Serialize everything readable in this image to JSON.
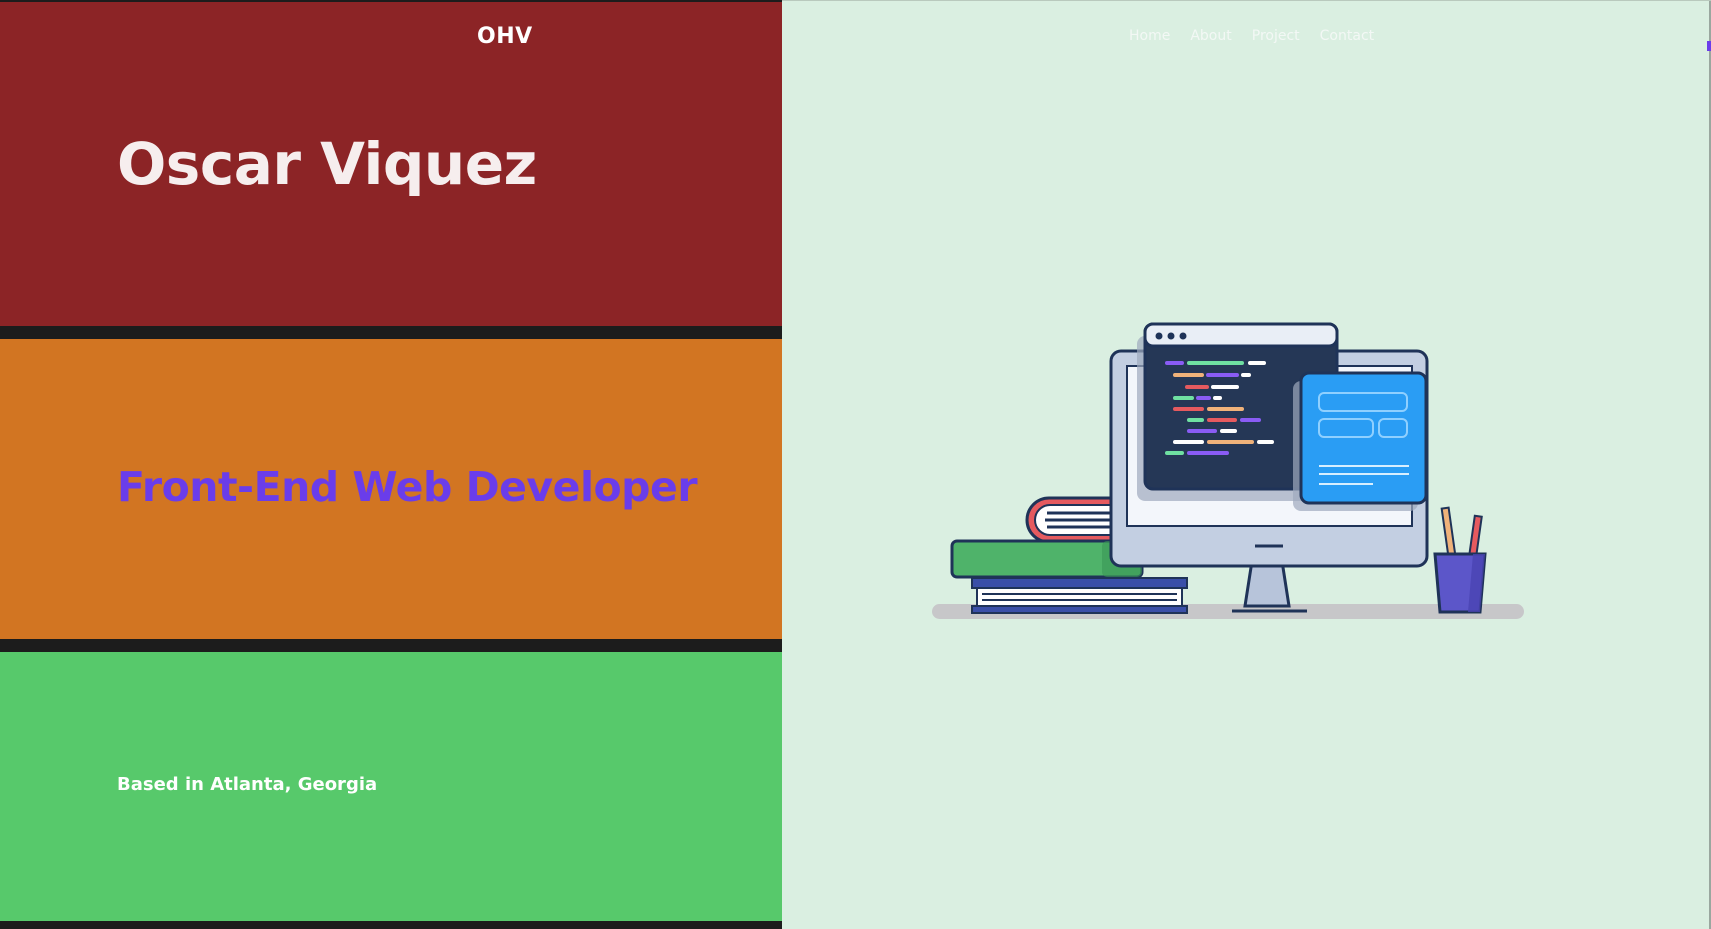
{
  "brand": {
    "logo": "OHV"
  },
  "nav": {
    "items": [
      {
        "label": "Home"
      },
      {
        "label": "About"
      },
      {
        "label": "Project"
      },
      {
        "label": "Contact"
      }
    ]
  },
  "hero": {
    "name": "Oscar Viquez",
    "role": "Front-End Web Developer",
    "location": "Based in Atlanta, Georgia"
  },
  "colors": {
    "red_band": "#8c2426",
    "orange_band": "#d27522",
    "green_band": "#57c96b",
    "role_text": "#6a3dea",
    "right_panel": "#daefe1"
  },
  "illustration": {
    "icon": "developer-desk-illustration"
  }
}
